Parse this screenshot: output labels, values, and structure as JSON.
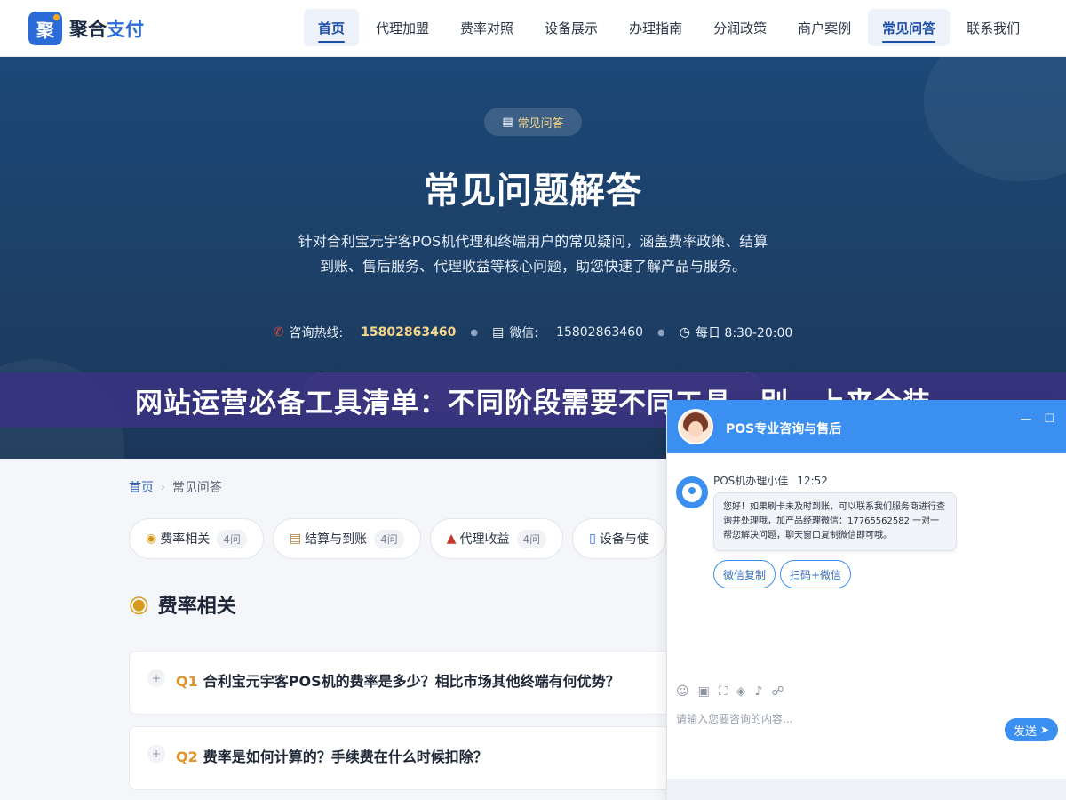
{
  "header": {
    "logo_mark": "聚",
    "logo_text_a": "聚合",
    "logo_text_b": "支付",
    "nav": [
      {
        "label": "首页",
        "active": true
      },
      {
        "label": "代理加盟"
      },
      {
        "label": "费率对照"
      },
      {
        "label": "设备展示"
      },
      {
        "label": "办理指南"
      },
      {
        "label": "分润政策"
      },
      {
        "label": "商户案例"
      },
      {
        "label": "常见问答",
        "active": true
      },
      {
        "label": "联系我们"
      }
    ]
  },
  "hero": {
    "badge_icon": "clipboard-icon",
    "badge": "常见问答",
    "title": "常见问题解答",
    "description": "针对合利宝元宇客POS机代理和终端用户的常见疑问，涵盖费率政策、结算到账、售后服务、代理收益等核心问题，助您快速了解产品与服务。",
    "contacts": {
      "hotline_label": "咨询热线:",
      "hotline_value": "15802863460",
      "wechat_label": "微信:",
      "wechat_value": "15802863460",
      "hours": "每日 8:30-20:00"
    }
  },
  "banner": {
    "text": "网站运营必备工具清单：不同阶段需要不同工具，别一上来全装"
  },
  "breadcrumb": {
    "home": "首页",
    "current": "常见问答"
  },
  "categories": [
    {
      "icon": "money-bag-icon",
      "label": "费率相关",
      "count": "4问"
    },
    {
      "icon": "clipboard-icon",
      "label": "结算与到账",
      "count": "4问"
    },
    {
      "icon": "chart-icon",
      "label": "代理收益",
      "count": "4问"
    },
    {
      "icon": "phone-icon",
      "label": "设备与使"
    }
  ],
  "section": {
    "icon": "money-bag-icon",
    "title": "费率相关"
  },
  "questions": [
    {
      "no": "Q1",
      "text": "合利宝元宇客POS机的费率是多少？相比市场其他终端有何优势？"
    },
    {
      "no": "Q2",
      "text": "费率是如何计算的？手续费在什么时候扣除？"
    }
  ],
  "chat": {
    "title": "POS专业咨询与售后",
    "agent_name": "POS机办理小佳",
    "time": "12:52",
    "message": "您好！如果刷卡未及时到账，可以联系我们服务商进行查询并处理哦，加产品经理微信：17765562582 一对一帮您解决问题，聊天窗口复制微信即可哦。",
    "button_copy": "微信复制",
    "button_scan": "扫码+微信",
    "input_placeholder": "请输入您要咨询的内容...",
    "send": "发送",
    "colors": {
      "accent": "#3b8ff0"
    }
  }
}
